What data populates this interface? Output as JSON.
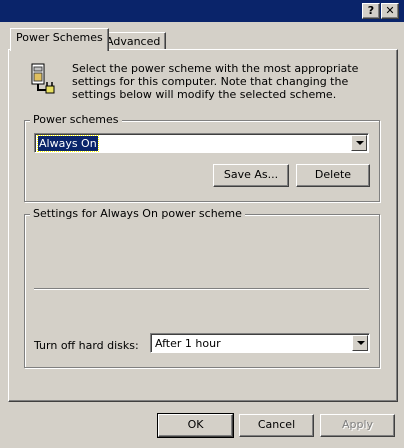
{
  "titlebar": {
    "help_label": "?",
    "close_label": "✕"
  },
  "tabs": [
    {
      "label": "Power Schemes",
      "active": true
    },
    {
      "label": "Advanced",
      "active": false
    }
  ],
  "description": "Select the power scheme with the most appropriate settings for this computer. Note that changing the settings below will modify the selected scheme.",
  "scheme_group": {
    "label": "Power schemes",
    "selected": "Always On",
    "save_as_label": "Save As...",
    "delete_label": "Delete"
  },
  "settings_group": {
    "label": "Settings for Always On power scheme",
    "hard_disks_label": "Turn off hard disks:",
    "hard_disks_value": "After 1 hour"
  },
  "footer": {
    "ok_label": "OK",
    "cancel_label": "Cancel",
    "apply_label": "Apply"
  },
  "icons": [
    "help-icon",
    "close-icon",
    "power-plug-icon",
    "dropdown-arrow-icon"
  ]
}
